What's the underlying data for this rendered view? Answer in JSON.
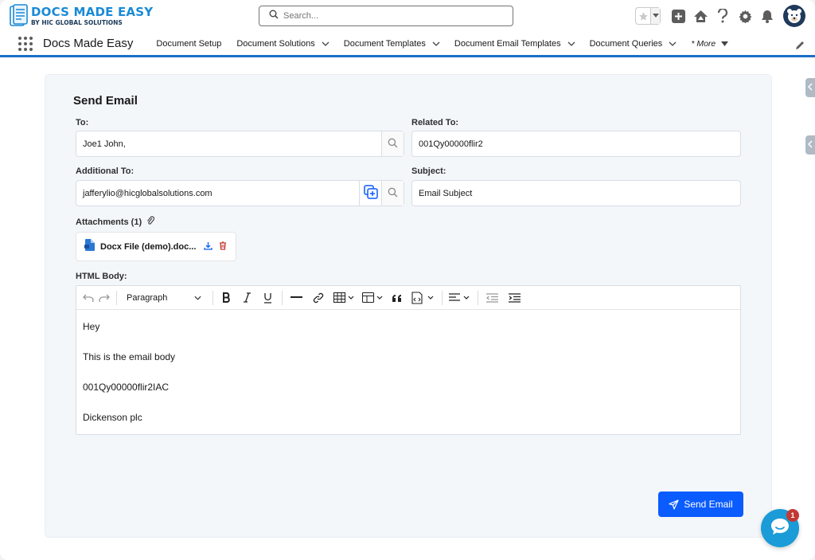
{
  "header": {
    "logo_main": "DOCS MADE EASY",
    "logo_sub": "BY HIC GLOBAL SOLUTIONS",
    "search_placeholder": "Search..."
  },
  "nav": {
    "app_name": "Docs Made Easy",
    "items": [
      {
        "label": "Document Setup",
        "has_menu": false
      },
      {
        "label": "Document Solutions",
        "has_menu": true
      },
      {
        "label": "Document Templates",
        "has_menu": true
      },
      {
        "label": "Document Email Templates",
        "has_menu": true
      },
      {
        "label": "Document Queries",
        "has_menu": true
      }
    ],
    "more_label": "* More"
  },
  "form": {
    "title": "Send Email",
    "to_label": "To:",
    "to_value": "Joe1 John,",
    "related_label": "Related To:",
    "related_value": "001Qy00000flir2",
    "additional_label": "Additional To:",
    "additional_value": "jafferylio@hicglobalsolutions.com",
    "subject_label": "Subject:",
    "subject_value": "Email Subject",
    "attachments_label": "Attachments (1)",
    "attachment_name": "Docx File (demo).doc...",
    "body_label": "HTML Body:",
    "paragraph_style": "Paragraph",
    "body_lines": [
      "Hey",
      "This is the email body",
      "001Qy00000flir2IAC",
      "Dickenson plc"
    ],
    "send_label": "Send Email"
  },
  "chat": {
    "badge_count": "1"
  },
  "colors": {
    "accent": "#0b5cff",
    "nav_underline": "#1b6fc7",
    "logo_blue": "#1a8ad6",
    "chat": "#1b9bd7",
    "badge": "#c23934"
  }
}
